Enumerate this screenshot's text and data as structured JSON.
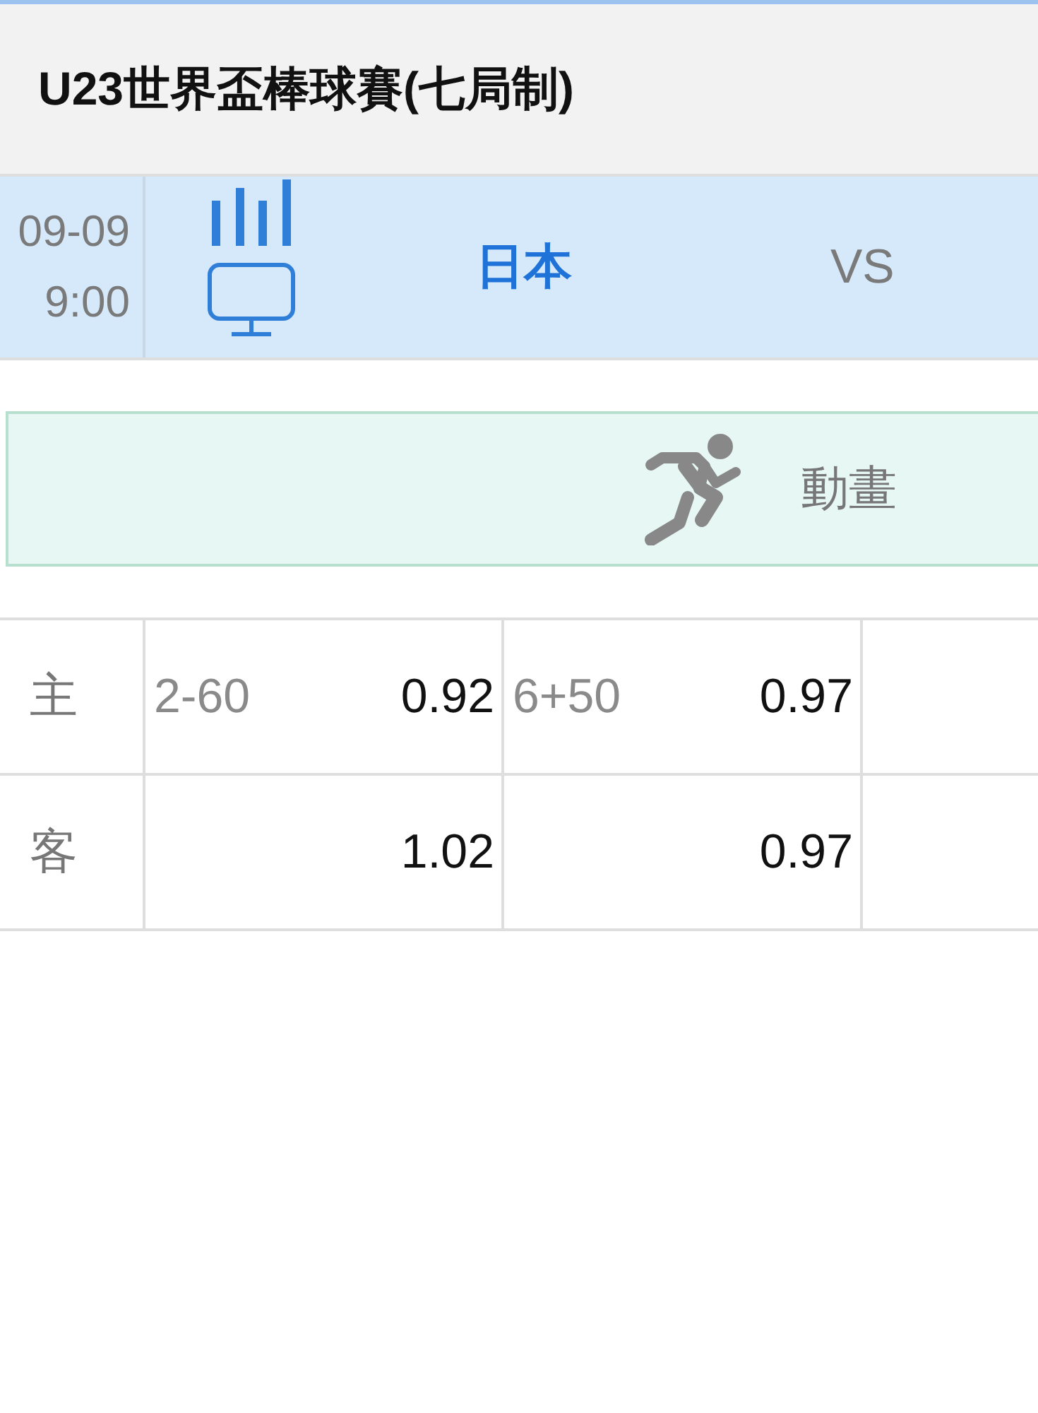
{
  "league": {
    "title": "U23世界盃棒球賽(七局制)"
  },
  "match": {
    "date": "09-09",
    "time": "9:00",
    "home_team": "日本",
    "vs": "VS"
  },
  "animation": {
    "label": "動畫"
  },
  "odds": {
    "rows": [
      {
        "side": "主",
        "cells": [
          {
            "line": "2-60",
            "odds": "0.92"
          },
          {
            "line": "6+50",
            "odds": "0.97"
          }
        ]
      },
      {
        "side": "客",
        "cells": [
          {
            "odds": "1.02"
          },
          {
            "odds": "0.97"
          }
        ]
      }
    ]
  }
}
